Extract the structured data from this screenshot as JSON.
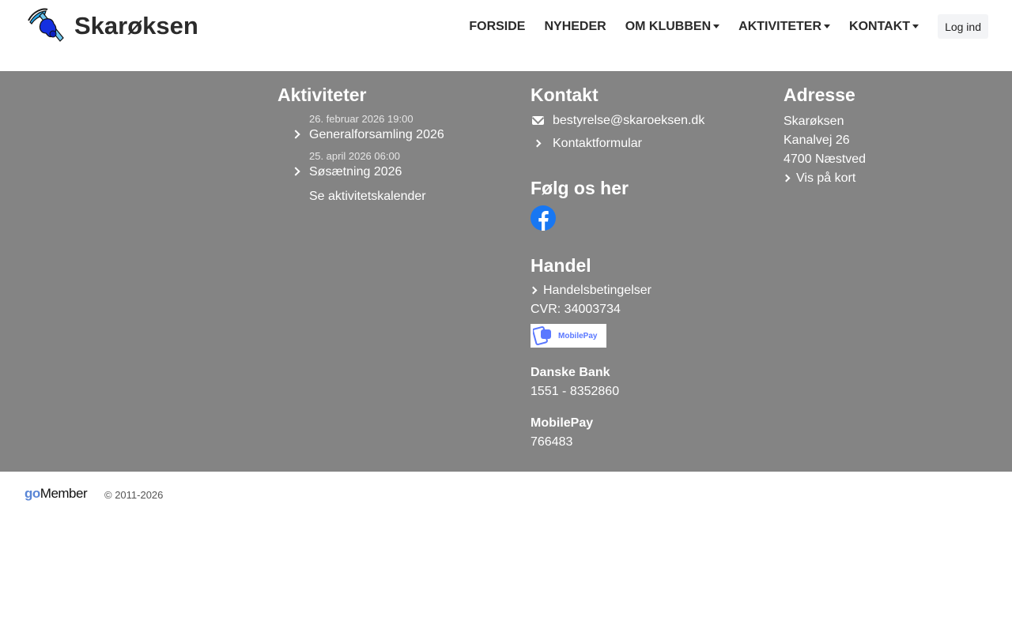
{
  "header": {
    "brand_name": "Skarøksen",
    "nav": [
      {
        "label": "FORSIDE",
        "dropdown": false
      },
      {
        "label": "NYHEDER",
        "dropdown": false
      },
      {
        "label": "OM KLUBBEN",
        "dropdown": true
      },
      {
        "label": "AKTIVITETER",
        "dropdown": true
      },
      {
        "label": "KONTAKT",
        "dropdown": true
      }
    ],
    "login_label": "Log ind"
  },
  "aktiviteter": {
    "title": "Aktiviteter",
    "events": [
      {
        "date": "26. februar 2026 19:00",
        "title": "Generalforsamling 2026"
      },
      {
        "date": "25. april 2026 06:00",
        "title": "Søsætning 2026"
      }
    ],
    "calendar_link": "Se aktivitetskalender"
  },
  "kontakt": {
    "title": "Kontakt",
    "email": "bestyrelse@skaroeksen.dk",
    "form_link": "Kontaktformular",
    "follow_title": "Følg os her",
    "handel_title": "Handel",
    "terms_link": "Handelsbetingelser",
    "cvr": "CVR: 34003734",
    "mobilepay_badge": "MobilePay",
    "bank_label": "Danske Bank",
    "bank_account": "1551 - 8352860",
    "mobilepay_label": "MobilePay",
    "mobilepay_number": "766483"
  },
  "adresse": {
    "title": "Adresse",
    "lines": [
      "Skarøksen",
      "Kanalvej 26",
      "4700 Næstved"
    ],
    "map_link": "Vis på kort"
  },
  "bottom": {
    "logo_go": "go",
    "logo_member": "Member",
    "copyright": "© 2011-2026"
  },
  "colors": {
    "footer_bg": "#848484",
    "facebook_blue": "#1877f2",
    "gomember_blue": "#5a86d6"
  }
}
